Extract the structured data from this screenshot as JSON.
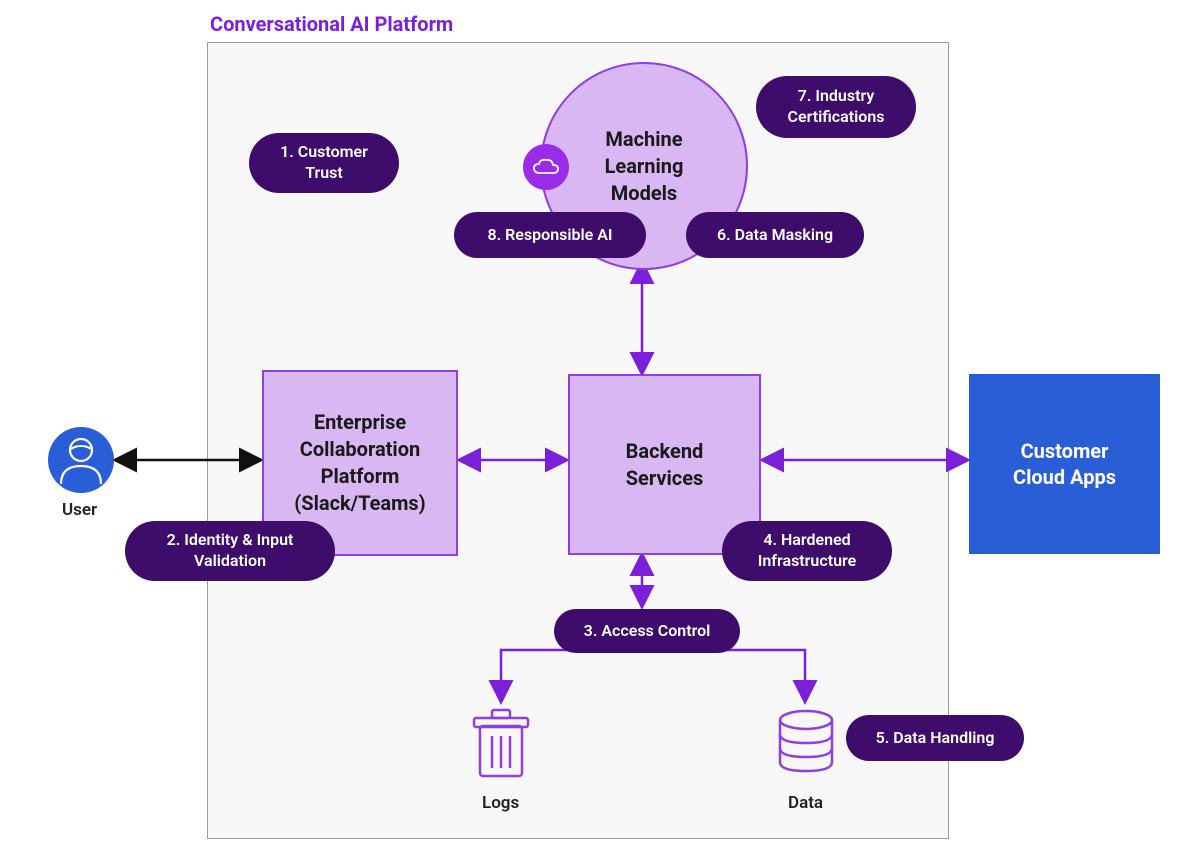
{
  "title": "Conversational AI Platform",
  "user_label": "User",
  "nodes": {
    "enterprise": "Enterprise\nCollaboration\nPlatform\n(Slack/Teams)",
    "backend": "Backend\nServices",
    "ml": "Machine\nLearning\nModels",
    "customer": "Customer\nCloud Apps",
    "logs": "Logs",
    "data": "Data"
  },
  "pills": {
    "p1": "1. Customer\nTrust",
    "p2": "2. Identity & Input\nValidation",
    "p3": "3. Access Control",
    "p4": "4. Hardened\nInfrastructure",
    "p5": "5. Data Handling",
    "p6": "6. Data Masking",
    "p7": "7. Industry\nCertifications",
    "p8": "8. Responsible AI"
  },
  "colors": {
    "purple": "#7b1fd9",
    "lavender_fill": "#d8b7f2",
    "pill_bg": "#3e0c6a",
    "blue": "#2a5ed6",
    "icon_purple": "#8f3fe0"
  }
}
